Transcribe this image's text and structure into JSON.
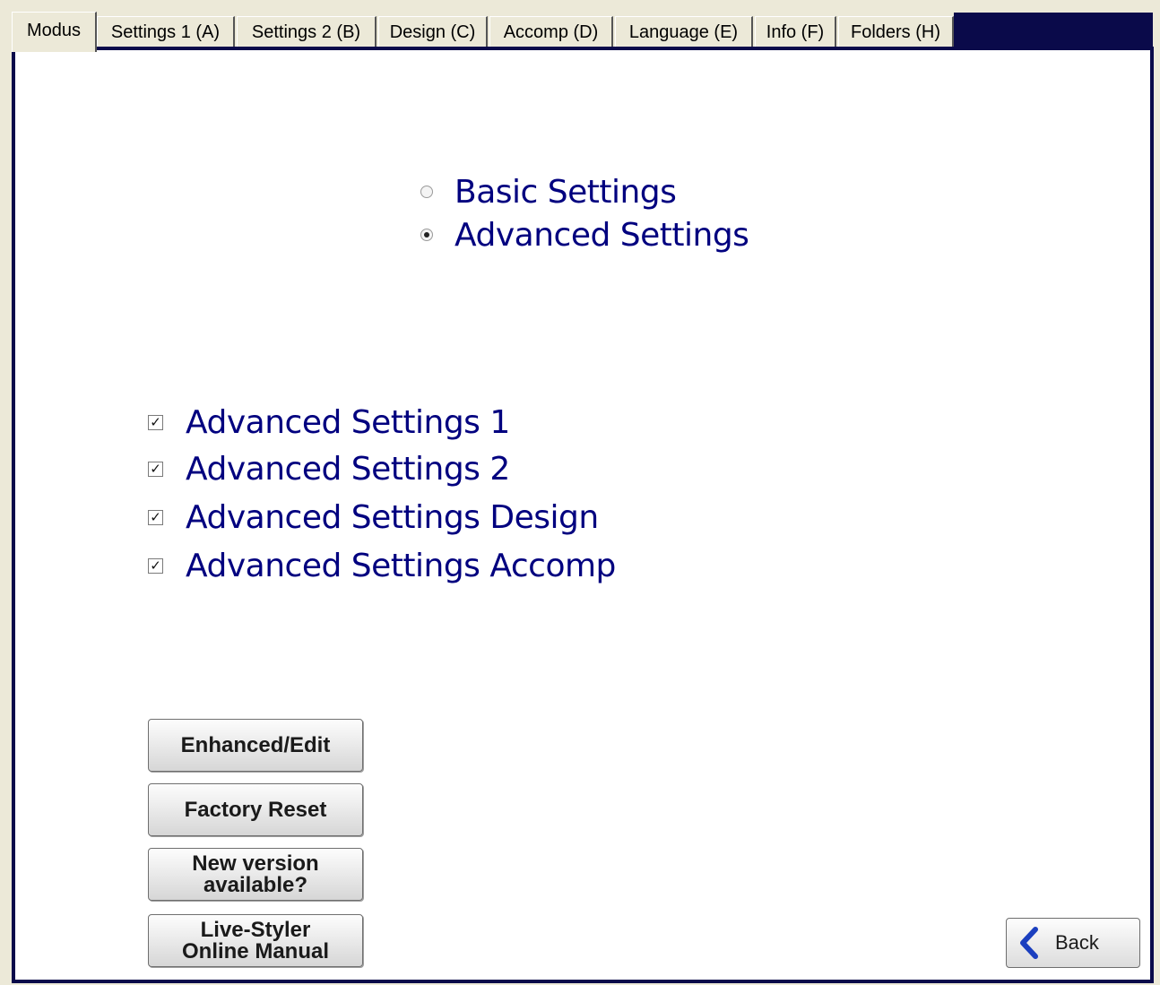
{
  "tabs": [
    {
      "label": "Modus",
      "active": true
    },
    {
      "label": "Settings 1 (A)",
      "active": false
    },
    {
      "label": "Settings 2 (B)",
      "active": false
    },
    {
      "label": "Design (C)",
      "active": false
    },
    {
      "label": "Accomp (D)",
      "active": false
    },
    {
      "label": "Language (E)",
      "active": false
    },
    {
      "label": "Info (F)",
      "active": false
    },
    {
      "label": "Folders (H)",
      "active": false
    }
  ],
  "mode": {
    "options": [
      {
        "label": "Basic Settings",
        "selected": false
      },
      {
        "label": "Advanced Settings",
        "selected": true
      }
    ]
  },
  "advanced": {
    "options": [
      {
        "label": "Advanced Settings 1",
        "checked": true
      },
      {
        "label": "Advanced Settings 2",
        "checked": true
      },
      {
        "label": "Advanced Settings Design",
        "checked": true
      },
      {
        "label": "Advanced Settings Accomp",
        "checked": true
      }
    ]
  },
  "buttons": {
    "enhanced_edit": "Enhanced/Edit",
    "factory_reset": "Factory Reset",
    "new_version": "New version\navailable?",
    "online_manual": "Live-Styler\nOnline Manual",
    "back": "Back"
  },
  "colors": {
    "frame": "#0a0a4a",
    "label_text": "#00007f",
    "back_arrow": "#1b3fbf"
  }
}
